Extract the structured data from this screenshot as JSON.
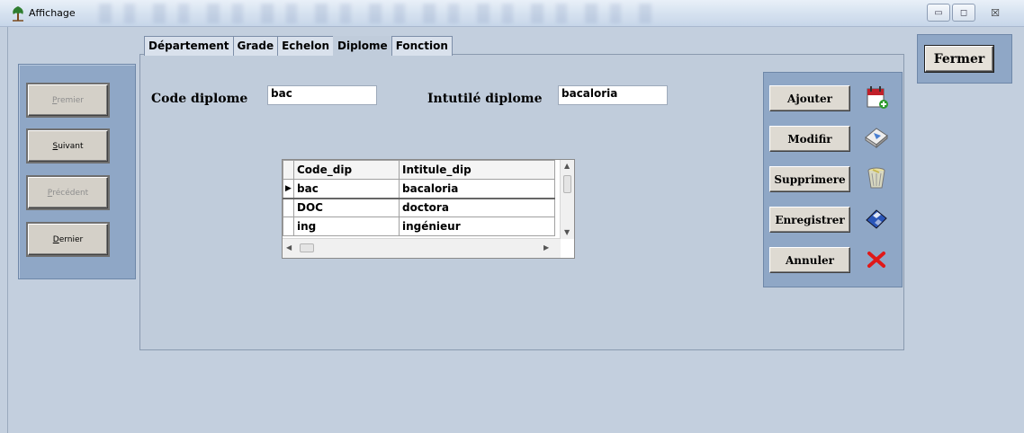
{
  "window": {
    "title": "Affichage",
    "controls": {
      "minimize": "▭",
      "maximize": "◻",
      "close": "☒"
    }
  },
  "tabs": [
    {
      "label": "Département"
    },
    {
      "label": "Grade"
    },
    {
      "label": "Echelon"
    },
    {
      "label": "Diplome",
      "active": true
    },
    {
      "label": "Fonction"
    }
  ],
  "nav": {
    "premier": {
      "first": "P",
      "rest": "remier",
      "enabled": false
    },
    "suivant": {
      "first": "S",
      "rest": "uivant",
      "enabled": true
    },
    "precedent": {
      "first": "P",
      "rest": "récédent",
      "enabled": false
    },
    "dernier": {
      "first": "D",
      "rest": "ernier",
      "enabled": true
    }
  },
  "form": {
    "code_label": "Code diplome",
    "code_value": "bac",
    "intitule_label": "Intutilé diplome",
    "intitule_value": "bacaloria"
  },
  "grid": {
    "columns": [
      "Code_dip",
      "Intitule_dip"
    ],
    "rows": [
      {
        "code": "bac",
        "intitule": "bacaloria",
        "current": true
      },
      {
        "code": "DOC",
        "intitule": "doctora"
      },
      {
        "code": "ing",
        "intitule": "ingénieur"
      }
    ]
  },
  "actions": {
    "ajouter": "Ajouter",
    "modifier": "Modifir",
    "supprimer": "Supprimere",
    "enregistrer": "Enregistrer",
    "annuler": "Annuler"
  },
  "fermer": "Fermer"
}
